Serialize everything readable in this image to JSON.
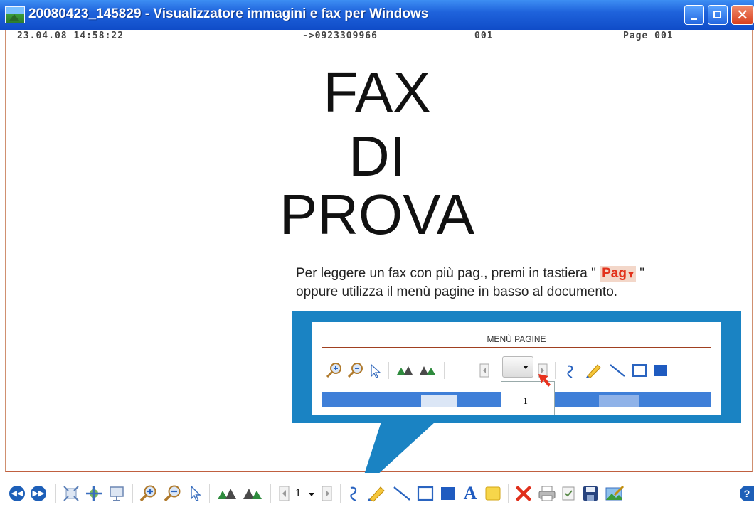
{
  "window": {
    "title": "20080423_145829  - Visualizzatore immagini e fax per Windows",
    "controls": {
      "minimize": "minimize",
      "maximize": "maximize",
      "close": "close"
    }
  },
  "fax_header": {
    "datetime": "23.04.08 14:58:22",
    "number": "->0923309966",
    "code": "001",
    "page": "Page 001"
  },
  "document": {
    "line1": "FAX",
    "line2": "DI",
    "line3": "PROVA",
    "instruction_part1": "Per leggere un fax con più pag., premi in tastiera \"",
    "pag_key": "Pag",
    "instruction_part2": "\"",
    "instruction_line2": "oppure utilizza il menù pagine in basso al documento."
  },
  "callout": {
    "title": "MENÙ PAGINE",
    "dropdown_value": "1"
  },
  "toolbar": {
    "page_value": "1",
    "colors": {
      "accent": "#1a83c3",
      "title_bar": "#1f63dc"
    }
  }
}
